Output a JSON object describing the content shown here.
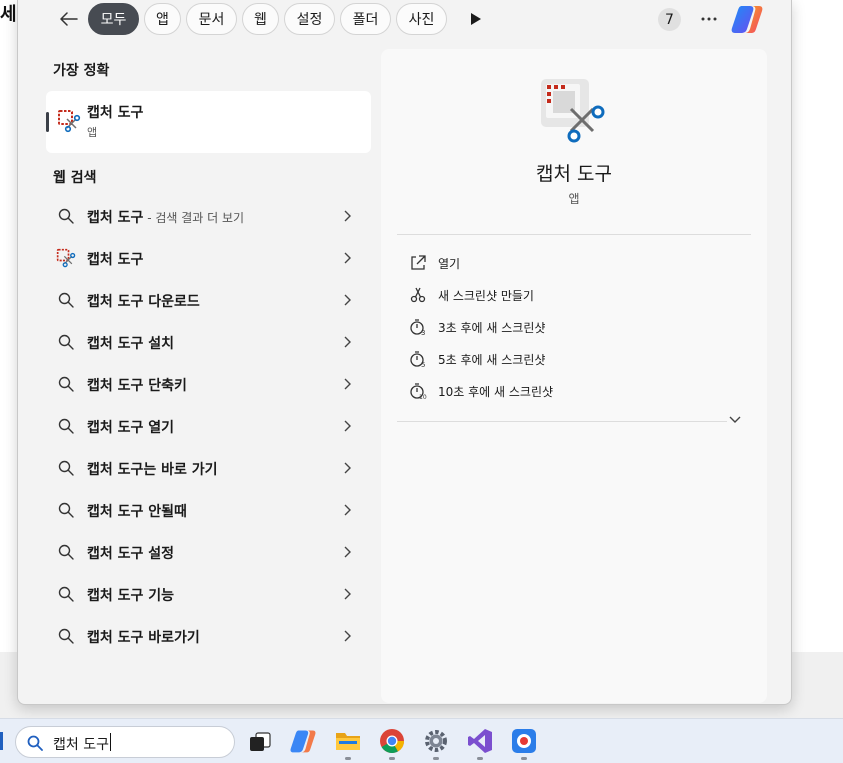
{
  "background": {
    "glyph": "세"
  },
  "topbar": {
    "filters": [
      {
        "label": "모두",
        "active": true
      },
      {
        "label": "앱",
        "active": false
      },
      {
        "label": "문서",
        "active": false
      },
      {
        "label": "웹",
        "active": false
      },
      {
        "label": "설정",
        "active": false
      },
      {
        "label": "폴더",
        "active": false
      },
      {
        "label": "사진",
        "active": false
      }
    ],
    "badge_count": "7"
  },
  "best_match": {
    "heading": "가장 정확",
    "title": "캡처 도구",
    "subtitle": "앱"
  },
  "web_search": {
    "heading": "웹 검색",
    "items": [
      {
        "label": "캡처 도구",
        "suffix": " - 검색 결과 더 보기",
        "icon": "search-icon"
      },
      {
        "label": "캡처 도구",
        "suffix": "",
        "icon": "snipping-tool-icon"
      },
      {
        "label": "캡처 도구 다운로드",
        "suffix": "",
        "icon": "search-icon"
      },
      {
        "label": "캡처 도구 설치",
        "suffix": "",
        "icon": "search-icon"
      },
      {
        "label": "캡처 도구 단축키",
        "suffix": "",
        "icon": "search-icon"
      },
      {
        "label": "캡처 도구 열기",
        "suffix": "",
        "icon": "search-icon"
      },
      {
        "label": "캡처 도구는 바로 가기",
        "suffix": "",
        "icon": "search-icon"
      },
      {
        "label": "캡처 도구 안될때",
        "suffix": "",
        "icon": "search-icon"
      },
      {
        "label": "캡처 도구 설정",
        "suffix": "",
        "icon": "search-icon"
      },
      {
        "label": "캡처 도구 기능",
        "suffix": "",
        "icon": "search-icon"
      },
      {
        "label": "캡처 도구 바로가기",
        "suffix": "",
        "icon": "search-icon"
      }
    ]
  },
  "detail": {
    "title": "캡처 도구",
    "subtitle": "앱",
    "actions": [
      {
        "label": "열기",
        "icon": "open-external-icon"
      },
      {
        "label": "새 스크린샷 만들기",
        "icon": "new-snip-icon"
      },
      {
        "label": "3초 후에 새 스크린샷",
        "icon": "timer-3-icon"
      },
      {
        "label": "5초 후에 새 스크린샷",
        "icon": "timer-5-icon"
      },
      {
        "label": "10초 후에 새 스크린샷",
        "icon": "timer-10-icon"
      }
    ]
  },
  "taskbar": {
    "search_value": "캡처 도구",
    "apps": [
      "task-view-icon",
      "copilot-icon",
      "file-explorer-icon",
      "chrome-icon",
      "settings-icon",
      "visual-studio-icon",
      "recorder-icon"
    ]
  },
  "colors": {
    "active_pill": "#474b52",
    "panel_bg": "#f3f3f3",
    "detail_bg": "#f9f9f9",
    "snip_red": "#c42b1c",
    "snip_blue": "#0f6cbd"
  }
}
